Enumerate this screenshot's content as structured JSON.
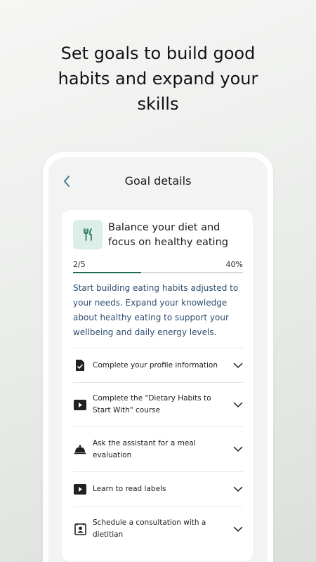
{
  "headline": {
    "line1": "Set goals to build good",
    "line2": "habits and expand your",
    "line3": "skills"
  },
  "screen": {
    "title": "Goal details",
    "back_icon": "chevron-left-icon"
  },
  "goal": {
    "icon": "fork-knife-icon",
    "title": "Balance your diet and focus on healthy eating",
    "progress_count": "2/5",
    "progress_percent_label": "40%",
    "progress_fraction": 0.4,
    "description": "Start building eating habits adjusted to your needs. Expand your knowledge about healthy eating to support your wellbeing and daily energy levels."
  },
  "tasks": [
    {
      "icon": "document-check-icon",
      "label": "Complete your profile information"
    },
    {
      "icon": "play-icon",
      "label": "Complete the \"Dietary Habits to Start With\" course"
    },
    {
      "icon": "cloche-icon",
      "label": "Ask the assistant for a meal evaluation"
    },
    {
      "icon": "play-icon",
      "label": "Learn to read labels"
    },
    {
      "icon": "contact-card-icon",
      "label": "Schedule a consultation with a dietitian"
    }
  ],
  "colors": {
    "accent": "#1e6b57",
    "icon_bg": "#dbeee8",
    "description_text": "#2d4f71",
    "back_icon": "#3f6f8f"
  }
}
